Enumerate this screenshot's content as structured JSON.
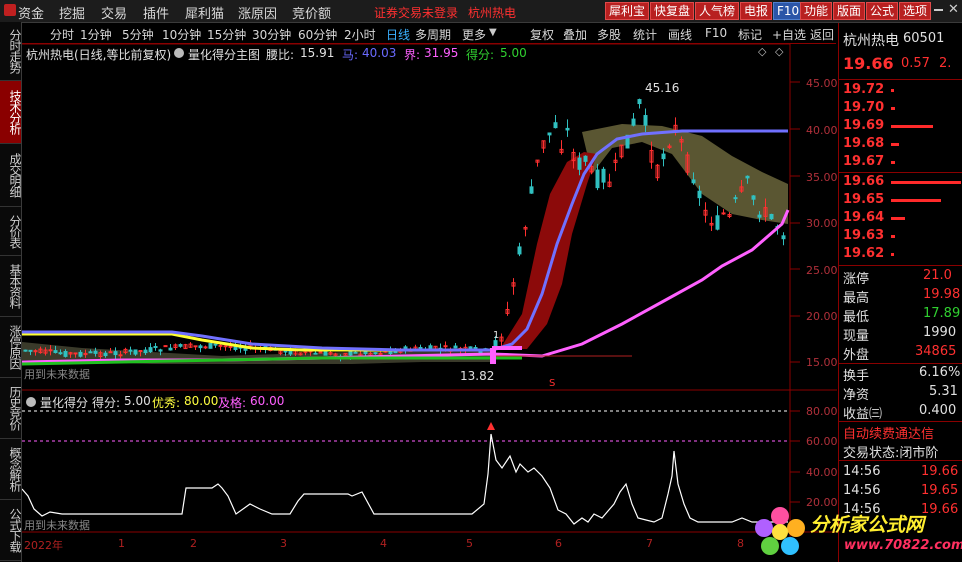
{
  "menu": {
    "items": [
      "资金",
      "挖掘",
      "交易",
      "插件",
      "犀利猫",
      "涨原因",
      "竞价额"
    ],
    "login_notice": "证券交易未登录",
    "stock": "杭州热电",
    "buttons": [
      "犀利宝",
      "快复盘",
      "人气榜",
      "电报",
      "F10",
      "功能",
      "版面",
      "公式",
      "选项"
    ]
  },
  "left_tabs": [
    "分时走势",
    "技术分析",
    "成交明细",
    "分价表",
    "基本资料",
    "涨停原因",
    "历史竞价",
    "概念解析",
    "公式下载"
  ],
  "period_bar": {
    "periods": [
      "分时",
      "1分钟",
      "5分钟",
      "10分钟",
      "15分钟",
      "30分钟",
      "60分钟",
      "2小时",
      "日线",
      "多周期",
      "更多"
    ],
    "selected": "日线",
    "tools": [
      "复权",
      "叠加",
      "多股",
      "统计",
      "画线",
      "F10",
      "标记",
      "+自选",
      "返回"
    ]
  },
  "main_chart": {
    "title": "杭州热电(日线,等比前复权)",
    "indicator": "量化得分主图",
    "items": [
      {
        "label": "腰比:",
        "value": "15.91",
        "color": "#e0e0e0"
      },
      {
        "label": "马:",
        "value": "40.03",
        "color": "#6a6aff"
      },
      {
        "label": "界:",
        "value": "31.95",
        "color": "#ff60ff"
      },
      {
        "label": "得分:",
        "value": "5.00",
        "color": "#30d030"
      }
    ],
    "high_label": "45.16",
    "low_label": "13.82",
    "future_note": "用到未来数据",
    "marker": "1",
    "s_marker": "S",
    "y_axis": [
      "45.00",
      "40.00",
      "35.00",
      "30.00",
      "25.00",
      "20.00",
      "15.00"
    ]
  },
  "sub_chart": {
    "title": "量化得分",
    "items": [
      {
        "label": "得分:",
        "value": "5.00",
        "color": "#e0e0e0"
      },
      {
        "label": "优秀:",
        "value": "80.00",
        "color": "#ffff40"
      },
      {
        "label": "及格:",
        "value": "60.00",
        "color": "#ff60ff"
      }
    ],
    "future_note": "用到未来数据",
    "y_axis": [
      "80.00",
      "60.00",
      "40.00",
      "20.00"
    ]
  },
  "x_axis": [
    "2022年",
    "1",
    "2",
    "3",
    "4",
    "5",
    "6",
    "7",
    "8"
  ],
  "right_panel": {
    "name": "杭州热电",
    "code": "60501",
    "price": "19.66",
    "change": "0.57",
    "pct": "2.",
    "asks": [
      "19.72",
      "19.70",
      "19.69",
      "19.68",
      "19.67"
    ],
    "ask_vols": [
      0.03,
      0.05,
      0.6,
      0.12,
      0.06
    ],
    "bids": [
      "19.66",
      "19.65",
      "19.64",
      "19.63",
      "19.62"
    ],
    "bid_vols": [
      1.0,
      0.72,
      0.2,
      0.06,
      0.04
    ],
    "stats": [
      {
        "label": "涨停",
        "value": "21.0",
        "color": "#ff3030"
      },
      {
        "label": "最高",
        "value": "19.98",
        "color": "#ff3030"
      },
      {
        "label": "最低",
        "value": "17.89",
        "color": "#30d030"
      },
      {
        "label": "现量",
        "value": "1990",
        "color": "#e0e0e0"
      },
      {
        "label": "外盘",
        "value": "34865",
        "color": "#ff3030"
      },
      {
        "label": "换手",
        "value": "6.16%",
        "color": "#e0e0e0"
      },
      {
        "label": "净资",
        "value": "5.31",
        "color": "#e0e0e0"
      },
      {
        "label": "收益㈢",
        "value": "0.400",
        "color": "#e0e0e0"
      }
    ],
    "renew": "自动续费通达信",
    "trade_status": "交易状态:闭市阶",
    "ticks": [
      {
        "time": "14:56",
        "price": "19.66"
      },
      {
        "time": "14:56",
        "price": "19.65"
      },
      {
        "time": "14:56",
        "price": "19.66"
      }
    ]
  },
  "watermark": {
    "title": "分析家公式网",
    "url": "www.70822.com"
  }
}
